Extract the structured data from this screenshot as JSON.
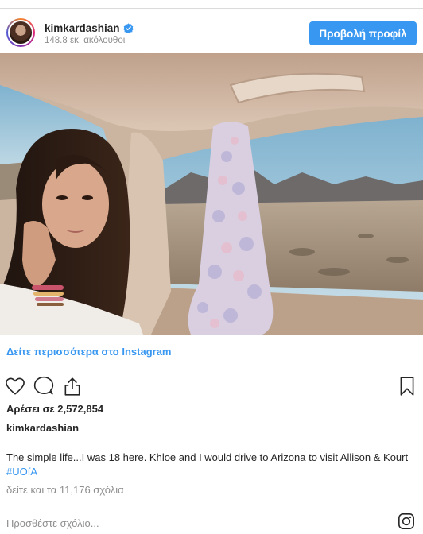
{
  "header": {
    "username": "kimkardashian",
    "followers": "148.8 εκ. ακόλουθοι",
    "profile_button": "Προβολή προφίλ"
  },
  "post": {
    "view_more": "Δείτε περισσότερα στο Instagram",
    "likes": "Αρέσει σε 2,572,854",
    "author": "kimkardashian",
    "caption_text": "The simple life...I was 18 here. Khloe and I would drive to Arizona to visit Allison & Kourt ",
    "caption_hashtag": "#UOfA",
    "comments_link": "δείτε και τα 11,176 σχόλια",
    "add_comment_placeholder": "Προσθέστε σχόλιο..."
  },
  "icons": {
    "verified": "verified-badge-icon",
    "like": "heart-icon",
    "comment": "comment-icon",
    "share": "share-icon",
    "save": "bookmark-icon",
    "instagram": "instagram-logo-icon"
  },
  "colors": {
    "accent": "#3897f0",
    "muted": "#8e8e8e",
    "text": "#262626"
  }
}
